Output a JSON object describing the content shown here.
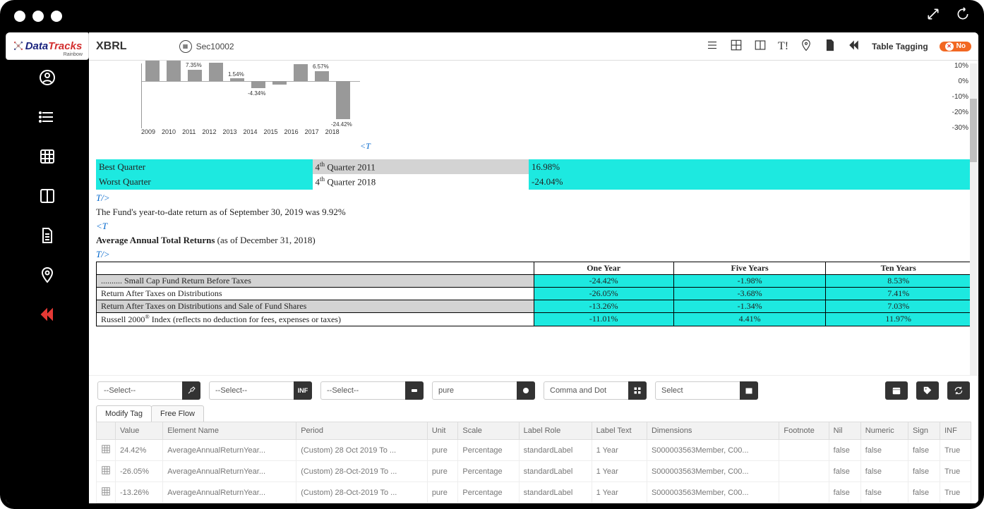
{
  "logo": {
    "brand1": "Data",
    "brand2": "Tracks",
    "sub": "Rainbow"
  },
  "topbar": {
    "title": "XBRL",
    "doc_id": "Sec10002",
    "table_tagging": "Table Tagging",
    "no": "No"
  },
  "chart_data": {
    "type": "bar",
    "categories": [
      "2009",
      "2010",
      "2011",
      "2012",
      "2013",
      "2014",
      "2015",
      "2016",
      "2017",
      "2018"
    ],
    "ylim": [
      -30,
      10
    ],
    "ytick_labels": [
      "10%",
      "0%",
      "-10%",
      "-20%",
      "-30%"
    ],
    "bar_labels": [
      "",
      "",
      "7.35%",
      "",
      "1.54%",
      "-4.34%",
      "",
      "",
      "6.57%",
      "-24.42%"
    ]
  },
  "t_open": "<T",
  "t_close": "T/>",
  "quarters": {
    "rows": [
      {
        "label": "Best Quarter",
        "period_pre": "4",
        "period_post": " Quarter 2011",
        "value": "16.98%"
      },
      {
        "label": "Worst Quarter",
        "period_pre": "4",
        "period_post": " Quarter 2018",
        "value": "-24.04%"
      }
    ]
  },
  "ytd": "The Fund's year-to-date return as of September 30, 2019 was 9.92%",
  "avg": {
    "head": "Average Annual Total Returns",
    "sub": " (as of December 31, 2018)"
  },
  "returns": {
    "headers": [
      "",
      "One Year",
      "Five Years",
      "Ten Years"
    ],
    "rows": [
      {
        "label": ".......... Small Cap Fund Return Before Taxes",
        "c1": "-24.42%",
        "c2": "-1.98%",
        "c3": "8.53%",
        "row_hl": true,
        "label_grey": true
      },
      {
        "label": "Return After Taxes on Distributions",
        "c1": "-26.05%",
        "c2": "-3.68%",
        "c3": "7.41%"
      },
      {
        "label": "Return After Taxes on Distributions and Sale of Fund Shares",
        "c1": "-13.26%",
        "c2": "-1.34%",
        "c3": "7.03%",
        "row_hl": true
      },
      {
        "label_pre": "Russell 2000",
        "label_sup": "®",
        "label_post": " Index (reflects no deduction for fees, expenses or taxes)",
        "c1": "-11.01%",
        "c2": "4.41%",
        "c3": "11.97%",
        "row_hl": true
      }
    ]
  },
  "selects": {
    "s1": "--Select--",
    "s2": "--Select--",
    "s3": "--Select--",
    "s4": "pure",
    "s5": "Comma and Dot",
    "s6": "Select",
    "inf": "INF"
  },
  "tabs": [
    {
      "label": "Modify Tag",
      "active": true
    },
    {
      "label": "Free Flow",
      "active": false
    }
  ],
  "grid": {
    "headers": [
      "",
      "Value",
      "Element Name",
      "Period",
      "Unit",
      "Scale",
      "Label Role",
      "Label Text",
      "Dimensions",
      "Footnote",
      "Nil",
      "Numeric",
      "Sign",
      "INF"
    ],
    "rows": [
      {
        "value": "24.42%",
        "element": "AverageAnnualReturnYear...",
        "period": "(Custom) 28 Oct 2019 To ...",
        "unit": "pure",
        "scale": "Percentage",
        "role": "standardLabel",
        "label": "1 Year",
        "dim": "S000003563Member, C00...",
        "foot": "",
        "nil": "false",
        "num": "false",
        "sign": "false",
        "inf": "True"
      },
      {
        "value": "-26.05%",
        "element": "AverageAnnualReturnYear...",
        "period": "(Custom) 28-Oct-2019 To ...",
        "unit": "pure",
        "scale": "Percentage",
        "role": "standardLabel",
        "label": "1 Year",
        "dim": "S000003563Member, C00...",
        "foot": "",
        "nil": "false",
        "num": "false",
        "sign": "false",
        "inf": "True"
      },
      {
        "value": "-13.26%",
        "element": "AverageAnnualReturnYear...",
        "period": "(Custom) 28-Oct-2019 To ...",
        "unit": "pure",
        "scale": "Percentage",
        "role": "standardLabel",
        "label": "1 Year",
        "dim": "S000003563Member, C00...",
        "foot": "",
        "nil": "false",
        "num": "false",
        "sign": "false",
        "inf": "True"
      }
    ]
  }
}
